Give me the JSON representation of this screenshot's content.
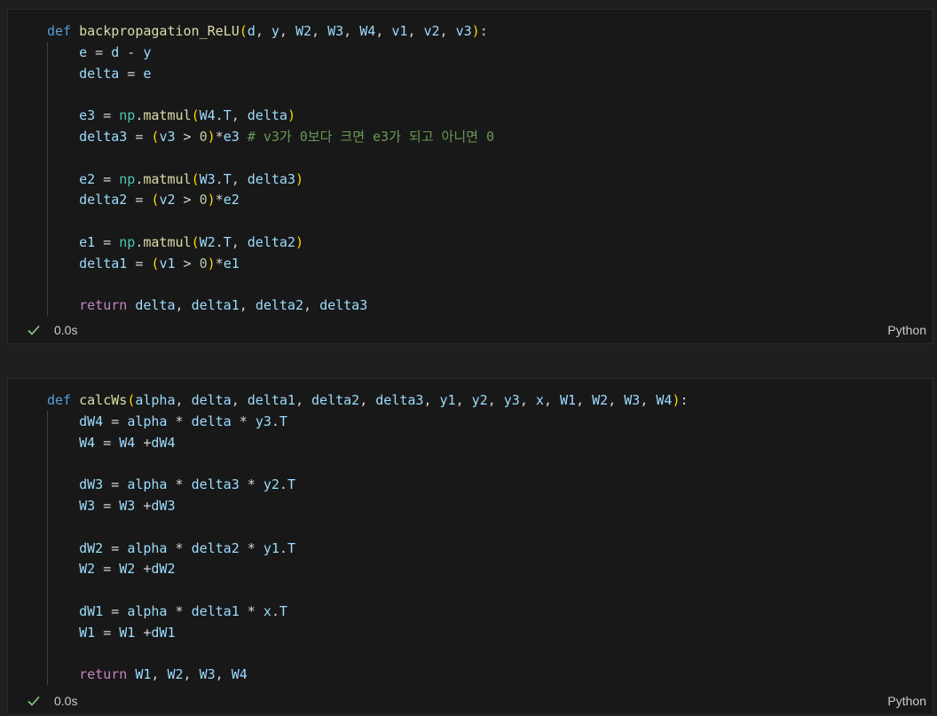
{
  "cells": [
    {
      "status": "0.0s",
      "language": "Python",
      "lines": [
        [
          [
            "kw",
            "def"
          ],
          [
            "op",
            " "
          ],
          [
            "fn",
            "backpropagation_ReLU"
          ],
          [
            "br1",
            "("
          ],
          [
            "var",
            "d"
          ],
          [
            "op",
            ", "
          ],
          [
            "var",
            "y"
          ],
          [
            "op",
            ", "
          ],
          [
            "var",
            "W2"
          ],
          [
            "op",
            ", "
          ],
          [
            "var",
            "W3"
          ],
          [
            "op",
            ", "
          ],
          [
            "var",
            "W4"
          ],
          [
            "op",
            ", "
          ],
          [
            "var",
            "v1"
          ],
          [
            "op",
            ", "
          ],
          [
            "var",
            "v2"
          ],
          [
            "op",
            ", "
          ],
          [
            "var",
            "v3"
          ],
          [
            "br1",
            ")"
          ],
          [
            "op",
            ":"
          ]
        ],
        [
          [
            "op",
            "    "
          ],
          [
            "var",
            "e"
          ],
          [
            "op",
            " = "
          ],
          [
            "var",
            "d"
          ],
          [
            "op",
            " - "
          ],
          [
            "var",
            "y"
          ]
        ],
        [
          [
            "op",
            "    "
          ],
          [
            "var",
            "delta"
          ],
          [
            "op",
            " = "
          ],
          [
            "var",
            "e"
          ]
        ],
        [],
        [
          [
            "op",
            "    "
          ],
          [
            "var",
            "e3"
          ],
          [
            "op",
            " = "
          ],
          [
            "cls",
            "np"
          ],
          [
            "op",
            "."
          ],
          [
            "fn",
            "matmul"
          ],
          [
            "br1",
            "("
          ],
          [
            "var",
            "W4"
          ],
          [
            "op",
            "."
          ],
          [
            "var",
            "T"
          ],
          [
            "op",
            ", "
          ],
          [
            "var",
            "delta"
          ],
          [
            "br1",
            ")"
          ]
        ],
        [
          [
            "op",
            "    "
          ],
          [
            "var",
            "delta3"
          ],
          [
            "op",
            " = "
          ],
          [
            "br1",
            "("
          ],
          [
            "var",
            "v3"
          ],
          [
            "op",
            " > "
          ],
          [
            "num",
            "0"
          ],
          [
            "br1",
            ")"
          ],
          [
            "op",
            "*"
          ],
          [
            "var",
            "e3"
          ],
          [
            "op",
            " "
          ],
          [
            "cm",
            "# v3가 0보다 크면 e3가 되고 아니면 0"
          ]
        ],
        [],
        [
          [
            "op",
            "    "
          ],
          [
            "var",
            "e2"
          ],
          [
            "op",
            " = "
          ],
          [
            "cls",
            "np"
          ],
          [
            "op",
            "."
          ],
          [
            "fn",
            "matmul"
          ],
          [
            "br1",
            "("
          ],
          [
            "var",
            "W3"
          ],
          [
            "op",
            "."
          ],
          [
            "var",
            "T"
          ],
          [
            "op",
            ", "
          ],
          [
            "var",
            "delta3"
          ],
          [
            "br1",
            ")"
          ]
        ],
        [
          [
            "op",
            "    "
          ],
          [
            "var",
            "delta2"
          ],
          [
            "op",
            " = "
          ],
          [
            "br1",
            "("
          ],
          [
            "var",
            "v2"
          ],
          [
            "op",
            " > "
          ],
          [
            "num",
            "0"
          ],
          [
            "br1",
            ")"
          ],
          [
            "op",
            "*"
          ],
          [
            "var",
            "e2"
          ]
        ],
        [],
        [
          [
            "op",
            "    "
          ],
          [
            "var",
            "e1"
          ],
          [
            "op",
            " = "
          ],
          [
            "cls",
            "np"
          ],
          [
            "op",
            "."
          ],
          [
            "fn",
            "matmul"
          ],
          [
            "br1",
            "("
          ],
          [
            "var",
            "W2"
          ],
          [
            "op",
            "."
          ],
          [
            "var",
            "T"
          ],
          [
            "op",
            ", "
          ],
          [
            "var",
            "delta2"
          ],
          [
            "br1",
            ")"
          ]
        ],
        [
          [
            "op",
            "    "
          ],
          [
            "var",
            "delta1"
          ],
          [
            "op",
            " = "
          ],
          [
            "br1",
            "("
          ],
          [
            "var",
            "v1"
          ],
          [
            "op",
            " > "
          ],
          [
            "num",
            "0"
          ],
          [
            "br1",
            ")"
          ],
          [
            "op",
            "*"
          ],
          [
            "var",
            "e1"
          ]
        ],
        [],
        [
          [
            "op",
            "    "
          ],
          [
            "ctl",
            "return"
          ],
          [
            "op",
            " "
          ],
          [
            "var",
            "delta"
          ],
          [
            "op",
            ", "
          ],
          [
            "var",
            "delta1"
          ],
          [
            "op",
            ", "
          ],
          [
            "var",
            "delta2"
          ],
          [
            "op",
            ", "
          ],
          [
            "var",
            "delta3"
          ]
        ]
      ]
    },
    {
      "status": "0.0s",
      "language": "Python",
      "lines": [
        [
          [
            "kw",
            "def"
          ],
          [
            "op",
            " "
          ],
          [
            "fn",
            "calcWs"
          ],
          [
            "br1",
            "("
          ],
          [
            "var",
            "alpha"
          ],
          [
            "op",
            ", "
          ],
          [
            "var",
            "delta"
          ],
          [
            "op",
            ", "
          ],
          [
            "var",
            "delta1"
          ],
          [
            "op",
            ", "
          ],
          [
            "var",
            "delta2"
          ],
          [
            "op",
            ", "
          ],
          [
            "var",
            "delta3"
          ],
          [
            "op",
            ", "
          ],
          [
            "var",
            "y1"
          ],
          [
            "op",
            ", "
          ],
          [
            "var",
            "y2"
          ],
          [
            "op",
            ", "
          ],
          [
            "var",
            "y3"
          ],
          [
            "op",
            ", "
          ],
          [
            "var",
            "x"
          ],
          [
            "op",
            ", "
          ],
          [
            "var",
            "W1"
          ],
          [
            "op",
            ", "
          ],
          [
            "var",
            "W2"
          ],
          [
            "op",
            ", "
          ],
          [
            "var",
            "W3"
          ],
          [
            "op",
            ", "
          ],
          [
            "var",
            "W4"
          ],
          [
            "br1",
            ")"
          ],
          [
            "op",
            ":"
          ]
        ],
        [
          [
            "op",
            "    "
          ],
          [
            "var",
            "dW4"
          ],
          [
            "op",
            " = "
          ],
          [
            "var",
            "alpha"
          ],
          [
            "op",
            " * "
          ],
          [
            "var",
            "delta"
          ],
          [
            "op",
            " * "
          ],
          [
            "var",
            "y3"
          ],
          [
            "op",
            "."
          ],
          [
            "var",
            "T"
          ]
        ],
        [
          [
            "op",
            "    "
          ],
          [
            "var",
            "W4"
          ],
          [
            "op",
            " = "
          ],
          [
            "var",
            "W4"
          ],
          [
            "op",
            " +"
          ],
          [
            "var",
            "dW4"
          ]
        ],
        [],
        [
          [
            "op",
            "    "
          ],
          [
            "var",
            "dW3"
          ],
          [
            "op",
            " = "
          ],
          [
            "var",
            "alpha"
          ],
          [
            "op",
            " * "
          ],
          [
            "var",
            "delta3"
          ],
          [
            "op",
            " * "
          ],
          [
            "var",
            "y2"
          ],
          [
            "op",
            "."
          ],
          [
            "var",
            "T"
          ]
        ],
        [
          [
            "op",
            "    "
          ],
          [
            "var",
            "W3"
          ],
          [
            "op",
            " = "
          ],
          [
            "var",
            "W3"
          ],
          [
            "op",
            " +"
          ],
          [
            "var",
            "dW3"
          ]
        ],
        [],
        [
          [
            "op",
            "    "
          ],
          [
            "var",
            "dW2"
          ],
          [
            "op",
            " = "
          ],
          [
            "var",
            "alpha"
          ],
          [
            "op",
            " * "
          ],
          [
            "var",
            "delta2"
          ],
          [
            "op",
            " * "
          ],
          [
            "var",
            "y1"
          ],
          [
            "op",
            "."
          ],
          [
            "var",
            "T"
          ]
        ],
        [
          [
            "op",
            "    "
          ],
          [
            "var",
            "W2"
          ],
          [
            "op",
            " = "
          ],
          [
            "var",
            "W2"
          ],
          [
            "op",
            " +"
          ],
          [
            "var",
            "dW2"
          ]
        ],
        [],
        [
          [
            "op",
            "    "
          ],
          [
            "var",
            "dW1"
          ],
          [
            "op",
            " = "
          ],
          [
            "var",
            "alpha"
          ],
          [
            "op",
            " * "
          ],
          [
            "var",
            "delta1"
          ],
          [
            "op",
            " * "
          ],
          [
            "var",
            "x"
          ],
          [
            "op",
            "."
          ],
          [
            "var",
            "T"
          ]
        ],
        [
          [
            "op",
            "    "
          ],
          [
            "var",
            "W1"
          ],
          [
            "op",
            " = "
          ],
          [
            "var",
            "W1"
          ],
          [
            "op",
            " +"
          ],
          [
            "var",
            "dW1"
          ]
        ],
        [],
        [
          [
            "op",
            "    "
          ],
          [
            "ctl",
            "return"
          ],
          [
            "op",
            " "
          ],
          [
            "var",
            "W1"
          ],
          [
            "op",
            ", "
          ],
          [
            "var",
            "W2"
          ],
          [
            "op",
            ", "
          ],
          [
            "var",
            "W3"
          ],
          [
            "op",
            ", "
          ],
          [
            "var",
            "W4"
          ]
        ]
      ]
    }
  ],
  "icons": {
    "status": "check-icon"
  },
  "colors": {
    "keyword": "#569cd6",
    "control": "#c586c0",
    "function": "#dcdcaa",
    "variable": "#9cdcfe",
    "module": "#4ec9b0",
    "number": "#b5cea8",
    "comment": "#6a9955",
    "bracket": "#ffd700",
    "success": "#89d185"
  }
}
